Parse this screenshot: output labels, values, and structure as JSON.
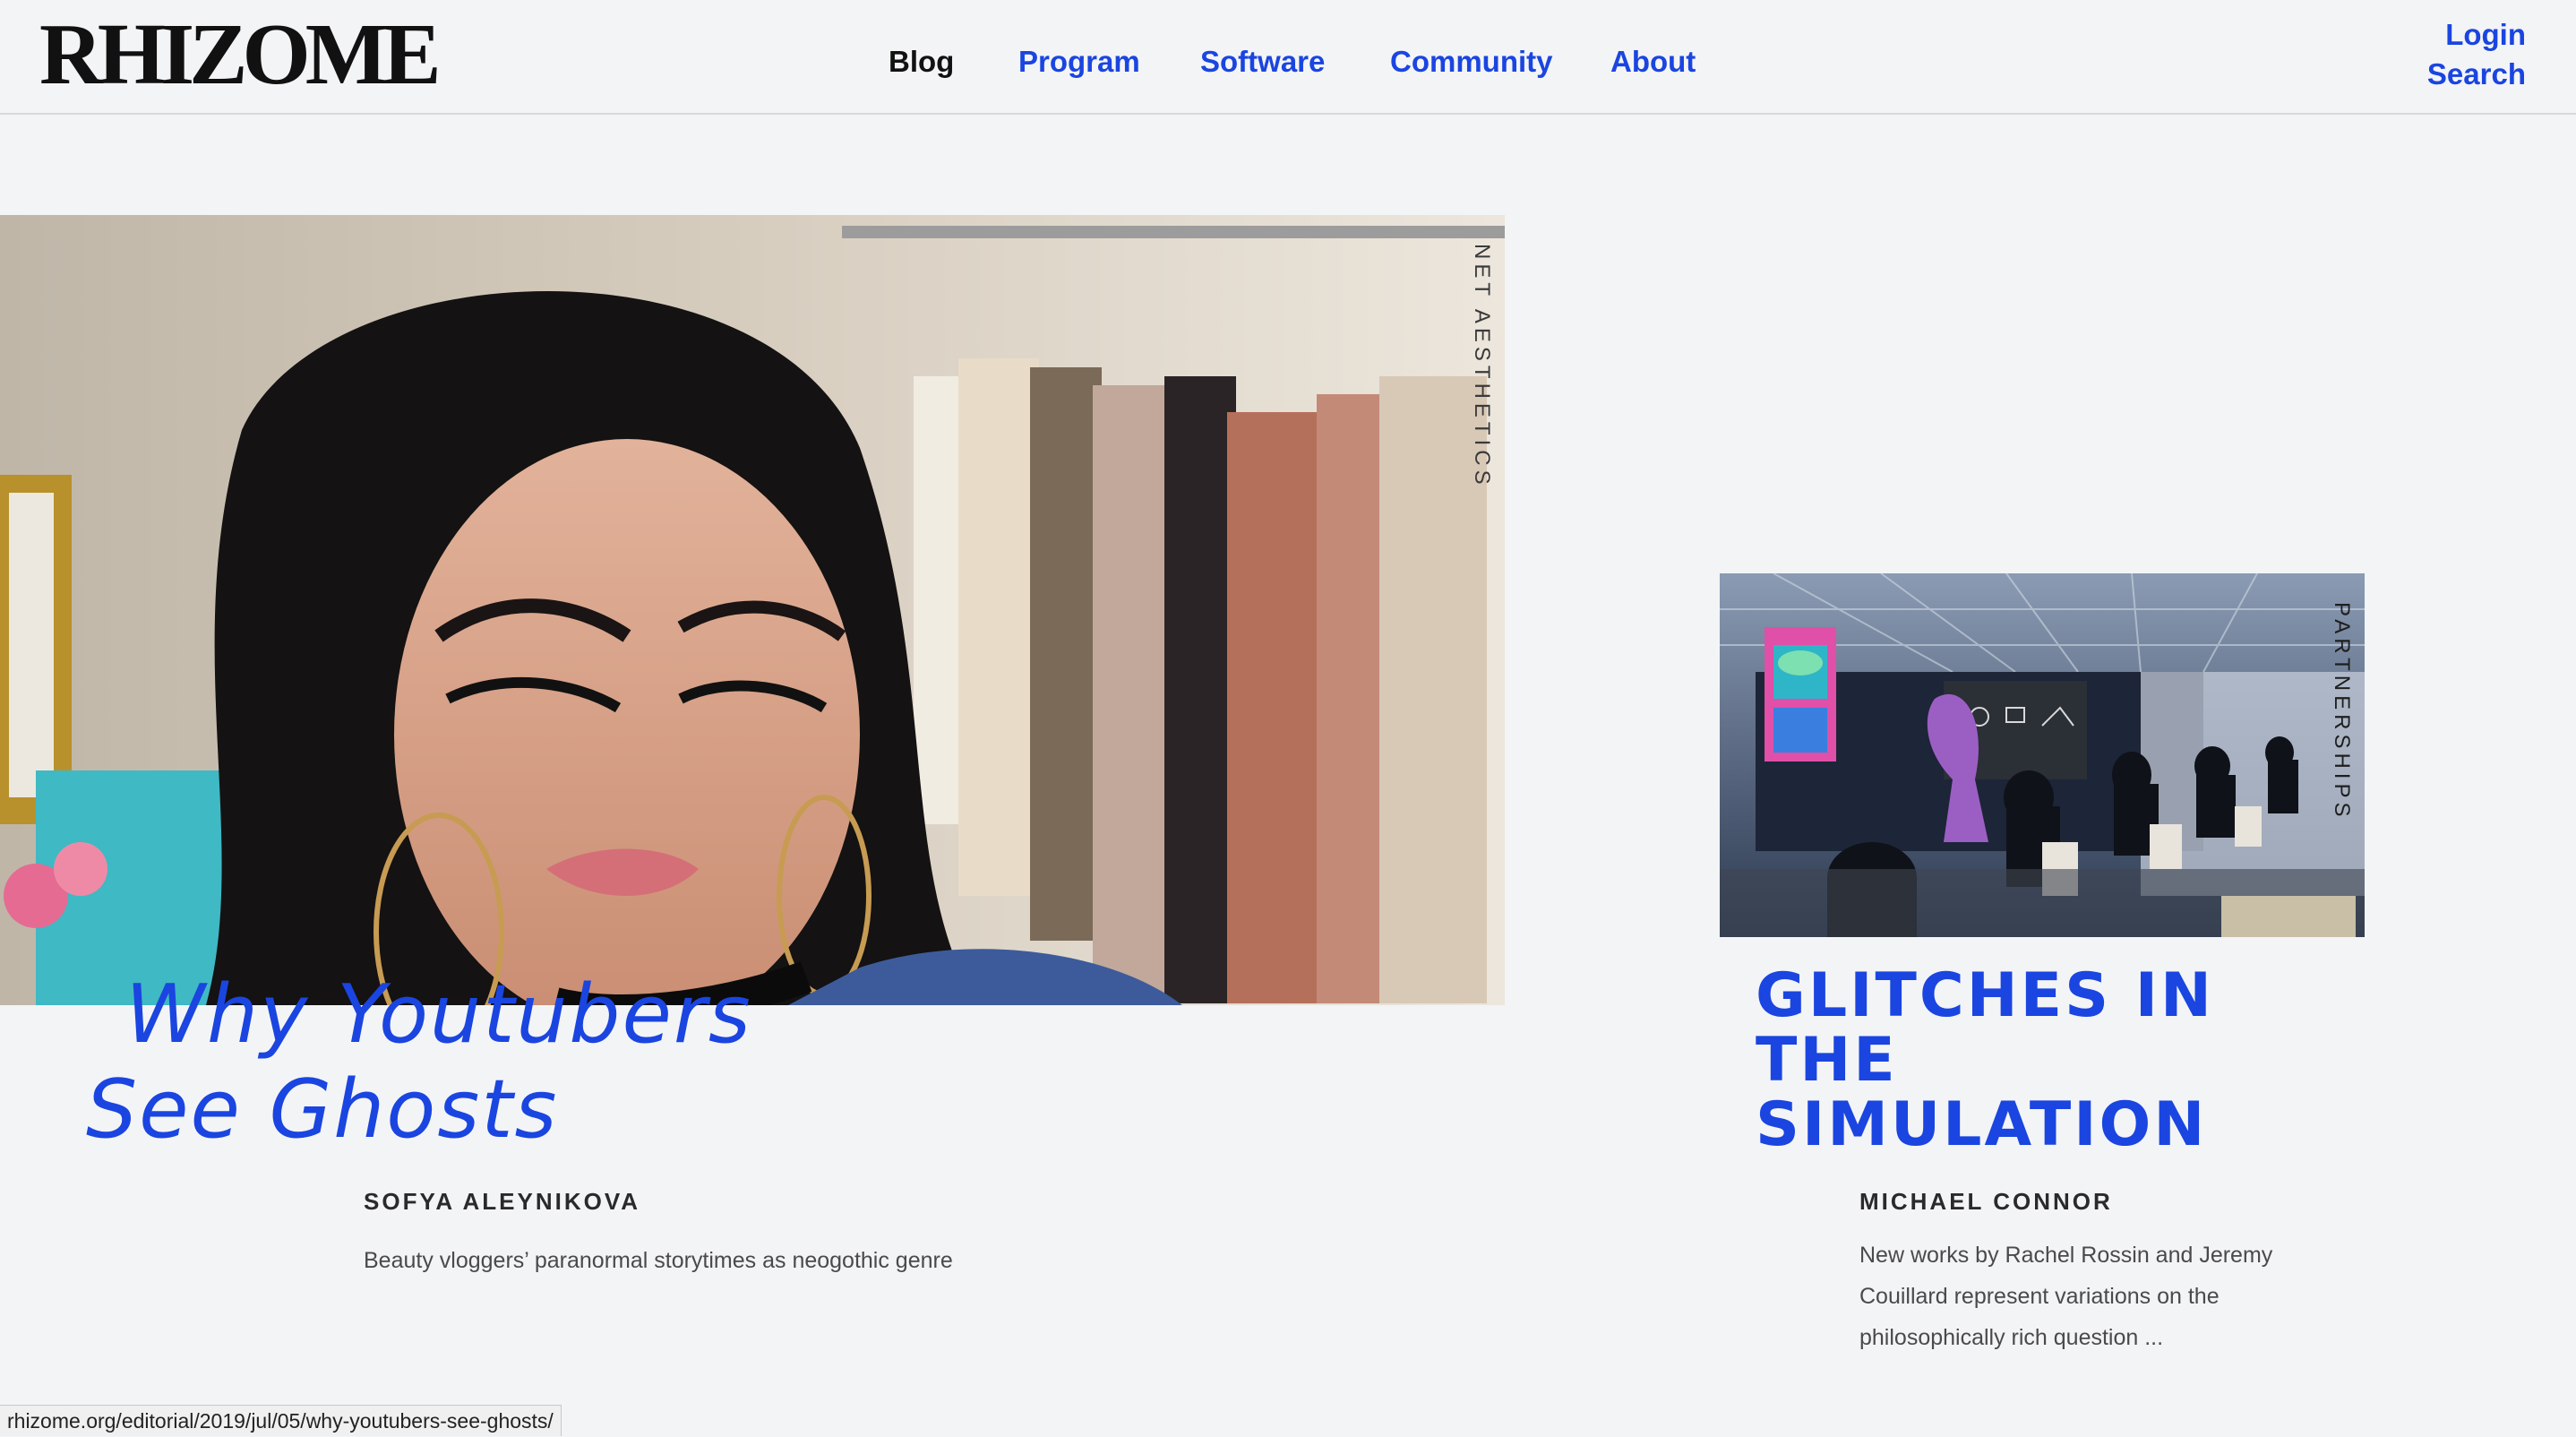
{
  "header": {
    "logo": "RHIZOME",
    "nav": [
      "Blog",
      "Program",
      "Software",
      "Community",
      "About"
    ],
    "active_nav": "Blog",
    "login_label": "Login",
    "search_label": "Search"
  },
  "features": [
    {
      "tag": "NET AESTHETICS",
      "title_line1": "Why Youtubers",
      "title_line2": "See Ghosts",
      "author": "SOFYA ALEYNIKOVA",
      "description": "Beauty vloggers’ paranormal storytimes as neogothic genre"
    },
    {
      "tag": "PARTNERSHIPS",
      "title": "GLITCHES IN THE SIMULATION",
      "author": "MICHAEL CONNOR",
      "description": "New works by Rachel Rossin and Jeremy Couillard represent variations on the philosophically rich question ..."
    }
  ],
  "status_bar": {
    "url": "rhizome.org/editorial/2019/jul/05/why-youtubers-see-ghosts/"
  },
  "colors": {
    "accent": "#1a45e0",
    "background": "#f3f4f6",
    "text": "#111111"
  }
}
